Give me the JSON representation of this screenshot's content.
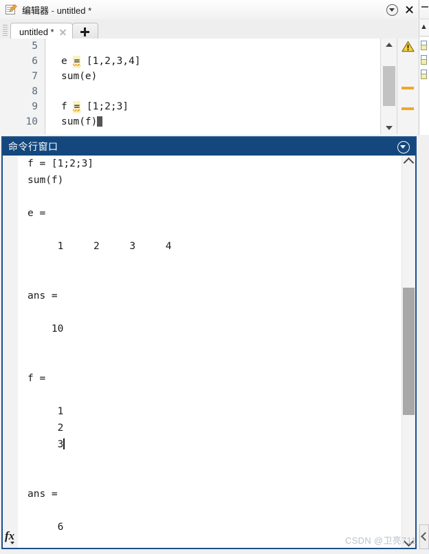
{
  "editor": {
    "title_cn": "编辑器",
    "title_sep": " - ",
    "title_file": "untitled *",
    "icon": "editor-pencil-icon",
    "dock_icon": "chevron-down-circle-icon",
    "close_icon": "close-icon",
    "tab": {
      "label": "untitled *",
      "close_icon": "tab-close-icon",
      "add_icon": "plus-icon",
      "add_label": "+"
    },
    "line_numbers": [
      "5",
      "6",
      "7",
      "8",
      "9",
      "10"
    ],
    "code_lines": [
      {
        "pre": "",
        "eq": "",
        "post": ""
      },
      {
        "pre": "e ",
        "eq": "=",
        "post": " [1,2,3,4]"
      },
      {
        "pre": "sum(e)",
        "eq": "",
        "post": ""
      },
      {
        "pre": "",
        "eq": "",
        "post": ""
      },
      {
        "pre": "f ",
        "eq": "=",
        "post": " [1;2;3]"
      },
      {
        "pre": "sum(f)",
        "eq": "",
        "post": ""
      }
    ],
    "scrollbar": {
      "up_icon": "scroll-up-arrow-icon",
      "down_icon": "scroll-down-arrow-icon"
    },
    "mlint": {
      "warning_icon": "warning-triangle-icon",
      "marker_count": 2
    },
    "colors": {
      "warning_highlight": "#fdf1bf",
      "warning_marker": "#f0a728",
      "gutter_text": "#5b6a79"
    }
  },
  "command_window": {
    "title": "命令行窗口",
    "dock_icon": "chevron-down-circle-icon",
    "fx_icon": "fx-function-browser-icon",
    "fx_label": "fx",
    "header_color": "#13477e",
    "border_color": "#1b4f8a",
    "lines": [
      "f = [1;2;3]",
      "sum(f)",
      "",
      "e =",
      "",
      "     1     2     3     4",
      "",
      "",
      "ans =",
      "",
      "    10",
      "",
      "",
      "f =",
      "",
      "     1",
      "     2",
      "     3",
      "",
      "",
      "ans =",
      "",
      "     6"
    ],
    "caret_after_line_index": 17,
    "scrollbar": {
      "up_icon": "chevron-up-icon",
      "down_icon": "chevron-down-icon"
    }
  },
  "right_panel": {
    "name": "workspace-panel-edge",
    "row_count": 3
  },
  "watermark": {
    "text": "CSDN @卫亮711"
  }
}
